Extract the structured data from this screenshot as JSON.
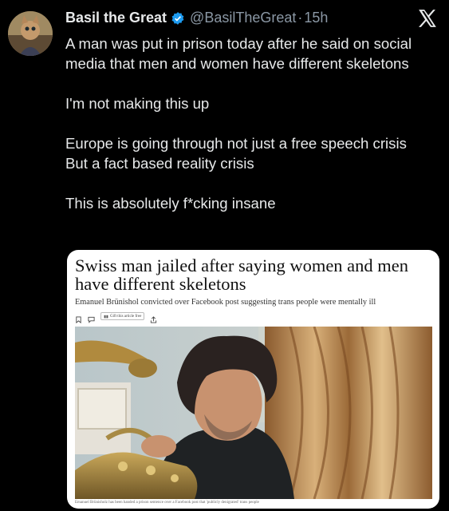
{
  "tweet": {
    "author_name": "Basil the Great",
    "handle": "@BasilTheGreat",
    "separator": "·",
    "time": "15h",
    "lines": [
      "A man was put in prison today after he said on social media that men and women have different skeletons",
      "I'm not making this up",
      "Europe is going through not just a free speech crisis",
      "But a fact based reality crisis",
      "This is absolutely f*cking insane"
    ]
  },
  "icons": {
    "verified": "verified-badge-icon",
    "platform": "x-logo-icon",
    "bookmark": "bookmark-icon",
    "comment": "comment-icon",
    "gift": "gift-icon",
    "share": "share-icon"
  },
  "card": {
    "headline": "Swiss man jailed after saying women and men have different skeletons",
    "subheadline": "Emanuel Brünishol convicted over Facebook post suggesting trans people were mentally ill",
    "gift_label": "Gift this article free",
    "caption": "Emanuel Brünisholz has been handed a prison sentence over a Facebook post that 'publicly denigrated' trans people"
  },
  "colors": {
    "background": "#000000",
    "text": "#e7e9ea",
    "muted": "#8b98a5",
    "verified": "#1d9bf0",
    "card": "#ffffff"
  }
}
